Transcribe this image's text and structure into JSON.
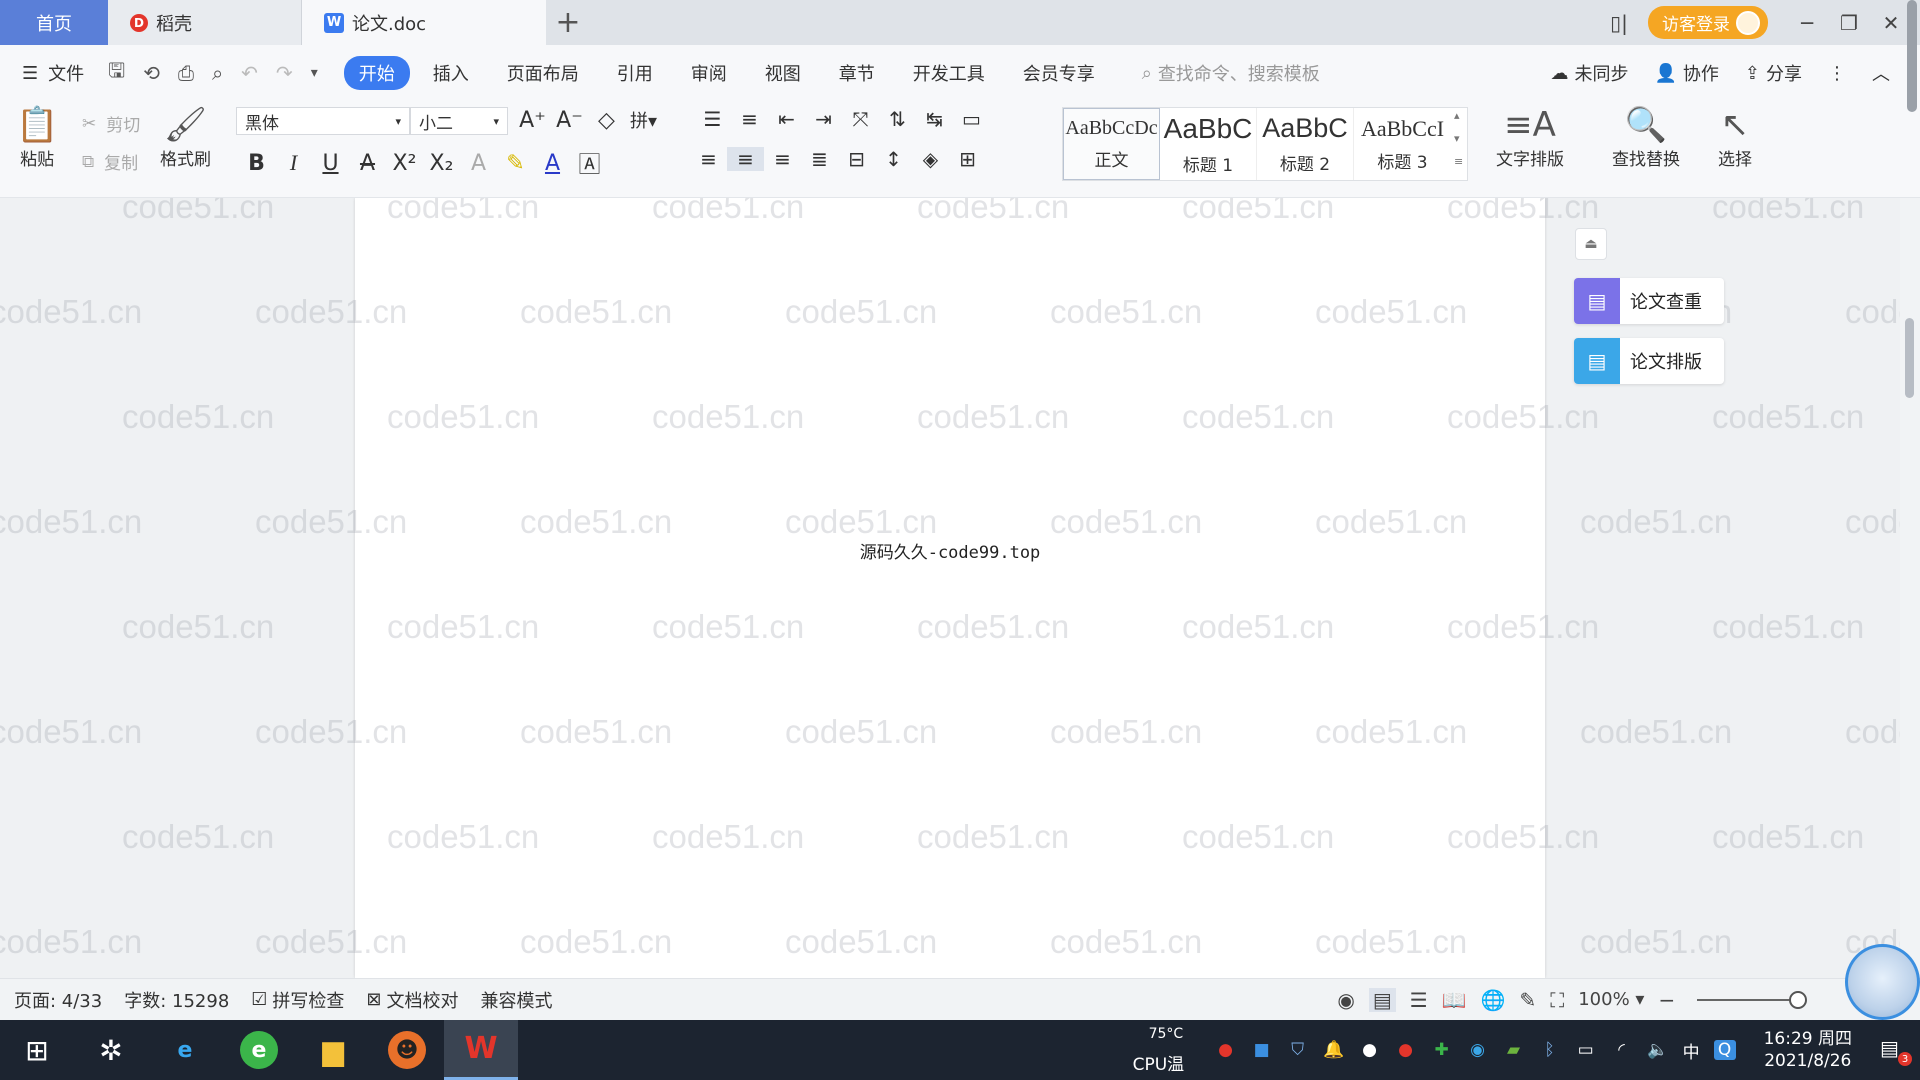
{
  "tabs": {
    "home": "首页",
    "daoke": "稻壳",
    "doc": "论文.doc",
    "add": "+"
  },
  "window": {
    "login": "访客登录",
    "layout_icon": "▯|",
    "minimize": "─",
    "restore": "❐",
    "close": "✕"
  },
  "menubar": {
    "file": "文件",
    "items": [
      "开始",
      "插入",
      "页面布局",
      "引用",
      "审阅",
      "视图",
      "章节",
      "开发工具",
      "会员专享"
    ],
    "search_placeholder": "查找命令、搜索模板",
    "unsynced": "未同步",
    "collab": "协作",
    "share": "分享"
  },
  "ribbon": {
    "paste": "粘贴",
    "cut": "剪切",
    "copy": "复制",
    "format_painter": "格式刷",
    "font_name": "黑体",
    "font_size": "小二",
    "styles": [
      {
        "sample": "AaBbCcDc",
        "name": "正文"
      },
      {
        "sample": "AaBbC",
        "name": "标题 1"
      },
      {
        "sample": "AaBbC",
        "name": "标题 2"
      },
      {
        "sample": "AaBbCcI",
        "name": "标题 3"
      }
    ],
    "text_layout": "文字排版",
    "find_replace": "查找替换",
    "select": "选择"
  },
  "document": {
    "body_text": "源码久久-code99.top",
    "watermark": "code51.cn"
  },
  "side_panel": {
    "check": "论文查重",
    "layout": "论文排版"
  },
  "statusbar": {
    "page": "页面: 4/33",
    "words": "字数: 15298",
    "spell": "拼写检查",
    "proof": "文档校对",
    "compat": "兼容模式",
    "zoom": "100%"
  },
  "taskbar": {
    "temp": "75°C",
    "temp_label": "CPU温度",
    "ime": "中",
    "time": "16:29 周四",
    "date": "2021/8/26",
    "notify_count": "3"
  },
  "colors": {
    "accent": "#3b7bf0",
    "login": "#f5a623",
    "home_tab": "#5a7fd8"
  }
}
